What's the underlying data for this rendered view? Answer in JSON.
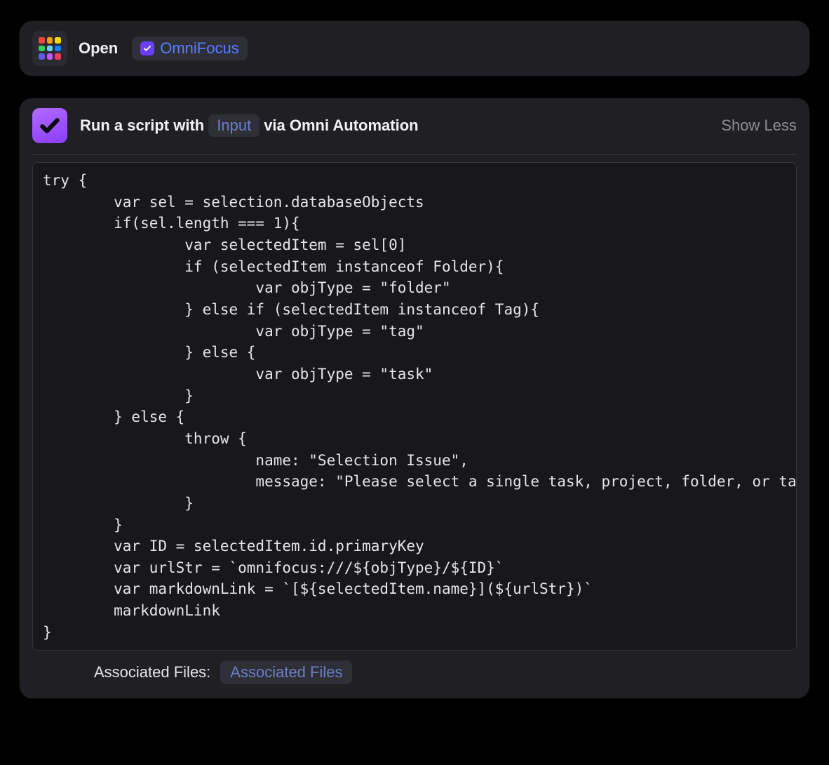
{
  "open_action": {
    "label": "Open",
    "app_name": "OmniFocus"
  },
  "script_action": {
    "title_prefix": "Run a script with",
    "input_token": "Input",
    "title_suffix": "via Omni Automation",
    "toggle_label": "Show Less",
    "code": "try {\n        var sel = selection.databaseObjects\n        if(sel.length === 1){\n                var selectedItem = sel[0]\n                if (selectedItem instanceof Folder){\n                        var objType = \"folder\"\n                } else if (selectedItem instanceof Tag){\n                        var objType = \"tag\"\n                } else {\n                        var objType = \"task\"\n                }\n        } else {\n                throw {\n                        name: \"Selection Issue\",\n                        message: \"Please select a single task, project, folder, or tag.\"\n                }\n        }\n        var ID = selectedItem.id.primaryKey\n        var urlStr = `omnifocus:///${objType}/${ID}`\n        var markdownLink = `[${selectedItem.name}](${urlStr})`\n        markdownLink\n}",
    "associated_files_label": "Associated Files:",
    "associated_files_token": "Associated Files"
  }
}
